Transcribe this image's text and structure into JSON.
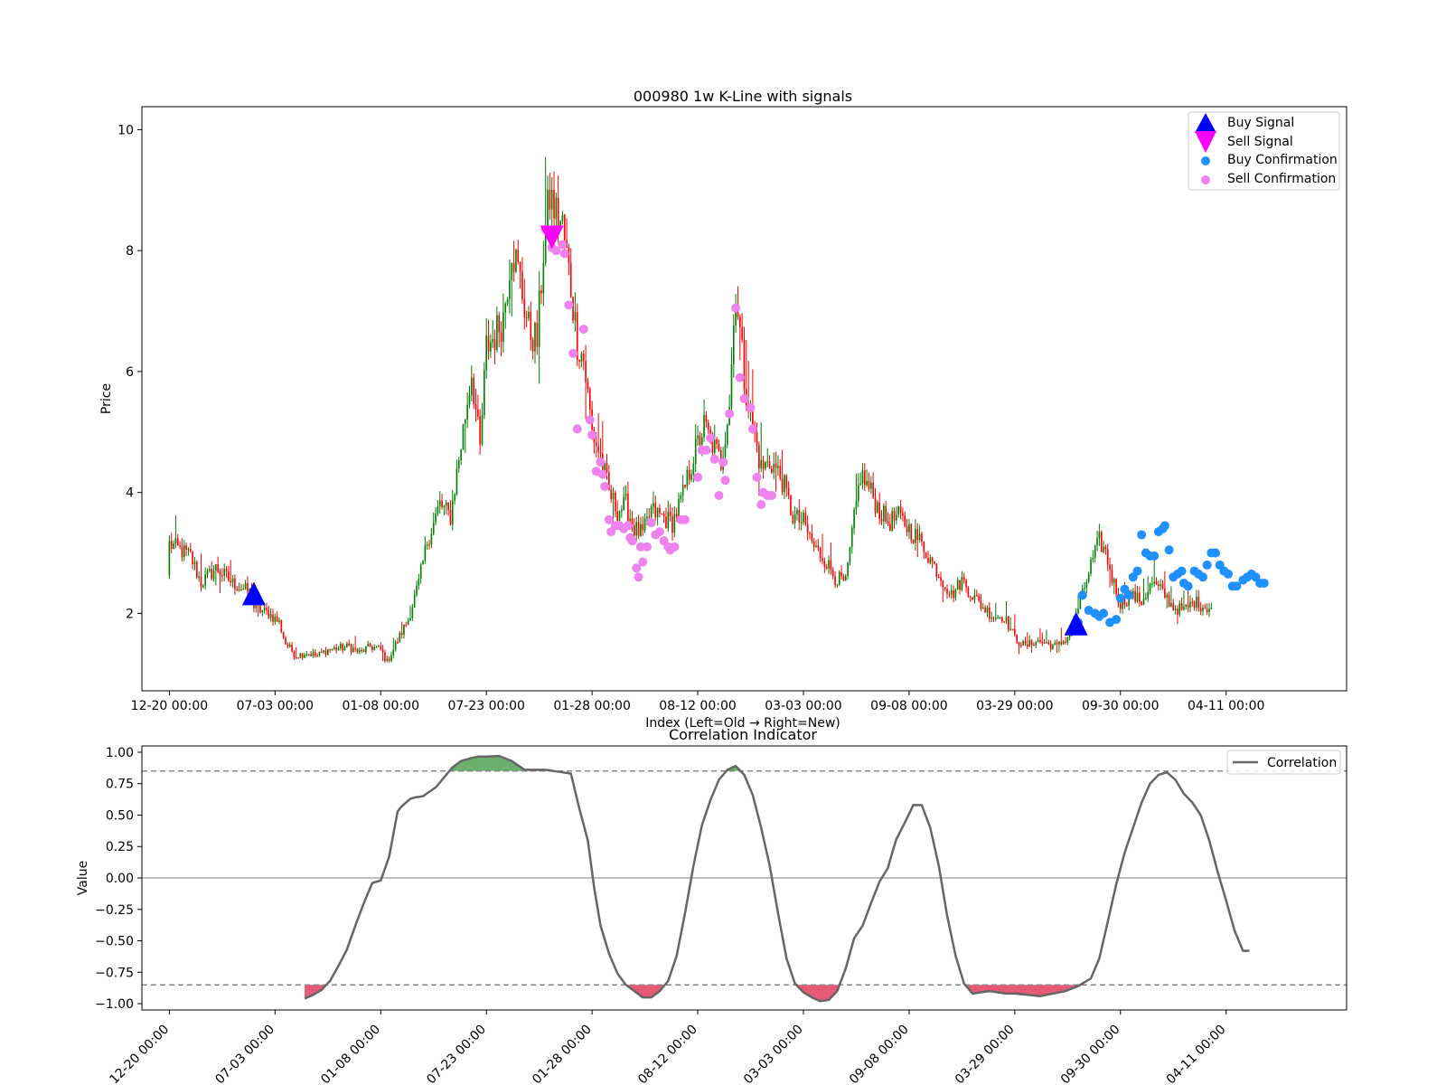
{
  "colors": {
    "up": "#008000",
    "down": "#ff0000",
    "buy_signal": "#0000ff",
    "sell_signal": "#ff00ff",
    "buy_confirmation": "#1e90ff",
    "sell_confirmation": "#ee82ee",
    "correlation_line": "#666666",
    "fill_high": "#2e8b2e",
    "fill_low": "#dc143c",
    "threshold": "#888888",
    "zero_line": "#aaaaaa"
  },
  "chart_data": [
    {
      "type": "candlestick",
      "title": "000980 1w K-Line with signals",
      "xlabel": "Index (Left=Old → Right=New)",
      "ylabel": "Price",
      "xlim": [
        -13,
        557
      ],
      "ylim": [
        0.72,
        10.38
      ],
      "yticks": [
        2,
        4,
        6,
        8,
        10
      ],
      "xtick_positions": [
        0,
        50,
        100,
        150,
        200,
        250,
        300,
        350,
        400,
        450,
        500
      ],
      "xtick_labels": [
        "12-20 00:00",
        "07-03 00:00",
        "01-08 00:00",
        "07-23 00:00",
        "01-28 00:00",
        "08-12 00:00",
        "03-03 00:00",
        "09-08 00:00",
        "03-29 00:00",
        "09-30 00:00",
        "04-11 00:00"
      ],
      "close_anchors": [
        [
          0,
          3.15
        ],
        [
          10,
          2.95
        ],
        [
          15,
          2.5
        ],
        [
          22,
          2.75
        ],
        [
          30,
          2.5
        ],
        [
          38,
          2.35
        ],
        [
          40,
          2.1
        ],
        [
          47,
          2.0
        ],
        [
          52,
          1.85
        ],
        [
          55,
          1.5
        ],
        [
          60,
          1.3
        ],
        [
          65,
          1.35
        ],
        [
          70,
          1.3
        ],
        [
          75,
          1.4
        ],
        [
          85,
          1.45
        ],
        [
          90,
          1.35
        ],
        [
          95,
          1.45
        ],
        [
          100,
          1.4
        ],
        [
          103,
          1.2
        ],
        [
          108,
          1.55
        ],
        [
          113,
          1.9
        ],
        [
          118,
          2.5
        ],
        [
          122,
          3.2
        ],
        [
          128,
          3.8
        ],
        [
          133,
          3.6
        ],
        [
          138,
          4.8
        ],
        [
          143,
          6.0
        ],
        [
          147,
          4.7
        ],
        [
          150,
          6.4
        ],
        [
          154,
          6.6
        ],
        [
          158,
          6.9
        ],
        [
          162,
          8.1
        ],
        [
          166,
          7.5
        ],
        [
          170,
          6.7
        ],
        [
          174,
          6.5
        ],
        [
          177,
          8.0
        ],
        [
          180,
          8.9
        ],
        [
          183,
          8.6
        ],
        [
          186,
          8.4
        ],
        [
          190,
          7.4
        ],
        [
          193,
          6.5
        ],
        [
          196,
          6.2
        ],
        [
          200,
          5.0
        ],
        [
          204,
          4.6
        ],
        [
          208,
          4.0
        ],
        [
          212,
          3.7
        ],
        [
          216,
          3.8
        ],
        [
          220,
          3.4
        ],
        [
          224,
          3.3
        ],
        [
          228,
          3.7
        ],
        [
          233,
          3.6
        ],
        [
          238,
          3.5
        ],
        [
          243,
          3.95
        ],
        [
          248,
          4.6
        ],
        [
          253,
          5.1
        ],
        [
          257,
          4.8
        ],
        [
          261,
          4.5
        ],
        [
          265,
          5.5
        ],
        [
          268,
          7.4
        ],
        [
          272,
          5.9
        ],
        [
          276,
          5.1
        ],
        [
          280,
          4.4
        ],
        [
          285,
          4.5
        ],
        [
          290,
          4.2
        ],
        [
          295,
          3.6
        ],
        [
          300,
          3.5
        ],
        [
          305,
          3.1
        ],
        [
          310,
          2.9
        ],
        [
          315,
          2.6
        ],
        [
          320,
          2.5
        ],
        [
          323,
          3.3
        ],
        [
          327,
          4.3
        ],
        [
          332,
          4.0
        ],
        [
          336,
          3.7
        ],
        [
          340,
          3.5
        ],
        [
          345,
          3.6
        ],
        [
          350,
          3.4
        ],
        [
          355,
          3.2
        ],
        [
          360,
          2.9
        ],
        [
          365,
          2.6
        ],
        [
          370,
          2.3
        ],
        [
          375,
          2.55
        ],
        [
          380,
          2.3
        ],
        [
          385,
          2.1
        ],
        [
          390,
          1.95
        ],
        [
          395,
          1.95
        ],
        [
          400,
          1.6
        ],
        [
          405,
          1.45
        ],
        [
          410,
          1.55
        ],
        [
          415,
          1.5
        ],
        [
          420,
          1.45
        ],
        [
          425,
          1.6
        ],
        [
          428,
          1.9
        ],
        [
          432,
          2.3
        ],
        [
          436,
          2.8
        ],
        [
          440,
          3.2
        ],
        [
          443,
          3.0
        ],
        [
          446,
          2.6
        ],
        [
          450,
          2.15
        ],
        [
          455,
          2.3
        ],
        [
          460,
          2.2
        ],
        [
          465,
          2.5
        ],
        [
          470,
          2.35
        ],
        [
          475,
          2.1
        ],
        [
          480,
          2.05
        ],
        [
          485,
          2.2
        ],
        [
          490,
          2.1
        ],
        [
          493,
          2.1
        ]
      ],
      "last_index": 493,
      "buy_signals": [
        [
          40,
          2.3
        ],
        [
          429,
          1.8
        ]
      ],
      "sell_signals": [
        [
          181,
          8.25
        ]
      ],
      "buy_confirmations": [
        [
          430,
          1.85
        ],
        [
          432,
          2.3
        ],
        [
          435,
          2.05
        ],
        [
          438,
          2.0
        ],
        [
          440,
          1.95
        ],
        [
          442,
          2.0
        ],
        [
          445,
          1.85
        ],
        [
          448,
          1.9
        ],
        [
          450,
          2.25
        ],
        [
          452,
          2.4
        ],
        [
          454,
          2.3
        ],
        [
          456,
          2.6
        ],
        [
          458,
          2.7
        ],
        [
          460,
          3.3
        ],
        [
          462,
          3.0
        ],
        [
          464,
          2.95
        ],
        [
          466,
          2.95
        ],
        [
          468,
          3.35
        ],
        [
          470,
          3.4
        ],
        [
          471,
          3.45
        ],
        [
          473,
          3.05
        ],
        [
          475,
          2.6
        ],
        [
          477,
          2.65
        ],
        [
          479,
          2.7
        ],
        [
          480,
          2.5
        ],
        [
          482,
          2.45
        ],
        [
          485,
          2.7
        ],
        [
          487,
          2.65
        ],
        [
          489,
          2.6
        ],
        [
          491,
          2.8
        ],
        [
          493,
          3.0
        ],
        [
          495,
          3.0
        ],
        [
          497,
          2.8
        ],
        [
          499,
          2.7
        ],
        [
          501,
          2.65
        ],
        [
          503,
          2.45
        ],
        [
          505,
          2.45
        ],
        [
          508,
          2.55
        ],
        [
          510,
          2.6
        ],
        [
          512,
          2.65
        ],
        [
          514,
          2.6
        ],
        [
          516,
          2.5
        ],
        [
          518,
          2.5
        ]
      ],
      "sell_confirmations": [
        [
          178,
          8.35
        ],
        [
          181,
          8.05
        ],
        [
          183,
          8.0
        ],
        [
          186,
          8.1
        ],
        [
          187,
          7.95
        ],
        [
          189,
          7.1
        ],
        [
          191,
          6.3
        ],
        [
          193,
          5.05
        ],
        [
          196,
          6.7
        ],
        [
          199,
          5.2
        ],
        [
          200,
          4.95
        ],
        [
          202,
          4.35
        ],
        [
          204,
          4.5
        ],
        [
          205,
          4.3
        ],
        [
          206,
          4.1
        ],
        [
          208,
          3.55
        ],
        [
          209,
          3.35
        ],
        [
          211,
          3.45
        ],
        [
          213,
          3.45
        ],
        [
          215,
          3.4
        ],
        [
          217,
          3.45
        ],
        [
          218,
          3.25
        ],
        [
          219,
          3.2
        ],
        [
          221,
          2.75
        ],
        [
          222,
          2.6
        ],
        [
          223,
          3.1
        ],
        [
          224,
          2.85
        ],
        [
          226,
          3.1
        ],
        [
          228,
          3.5
        ],
        [
          230,
          3.3
        ],
        [
          232,
          3.35
        ],
        [
          234,
          3.2
        ],
        [
          236,
          3.1
        ],
        [
          237,
          3.05
        ],
        [
          239,
          3.1
        ],
        [
          242,
          3.55
        ],
        [
          244,
          3.55
        ],
        [
          250,
          4.25
        ],
        [
          252,
          4.7
        ],
        [
          254,
          4.7
        ],
        [
          256,
          4.9
        ],
        [
          258,
          4.55
        ],
        [
          260,
          3.95
        ],
        [
          262,
          4.5
        ],
        [
          263,
          4.2
        ],
        [
          265,
          5.3
        ],
        [
          268,
          7.05
        ],
        [
          270,
          5.9
        ],
        [
          272,
          5.55
        ],
        [
          275,
          5.4
        ],
        [
          276,
          5.05
        ],
        [
          278,
          4.25
        ],
        [
          280,
          3.8
        ],
        [
          281,
          4.0
        ],
        [
          283,
          3.95
        ],
        [
          285,
          3.95
        ]
      ],
      "legend": {
        "placement": "upper right",
        "entries": [
          "Buy Signal",
          "Sell Signal",
          "Buy Confirmation",
          "Sell Confirmation"
        ]
      }
    },
    {
      "type": "line",
      "title": "Correlation Indicator",
      "ylabel": "Value",
      "xlim": [
        -13,
        557
      ],
      "ylim": [
        -1.05,
        1.05
      ],
      "yticks": [
        -1.0,
        -0.75,
        -0.5,
        -0.25,
        0.0,
        0.25,
        0.5,
        0.75,
        1.0
      ],
      "ytick_labels": [
        "−1.00",
        "−0.75",
        "−0.50",
        "−0.25",
        "0.00",
        "0.25",
        "0.50",
        "0.75",
        "1.00"
      ],
      "xtick_positions": [
        0,
        50,
        100,
        150,
        200,
        250,
        300,
        350,
        400,
        450,
        500
      ],
      "xtick_labels": [
        "12-20 00:00",
        "07-03 00:00",
        "01-08 00:00",
        "07-23 00:00",
        "01-28 00:00",
        "08-12 00:00",
        "03-03 00:00",
        "09-08 00:00",
        "03-29 00:00",
        "09-30 00:00",
        "04-11 00:00"
      ],
      "thresholds": [
        0.85,
        -0.85
      ],
      "zero_line": 0,
      "legend": {
        "placement": "upper right",
        "entries": [
          "Correlation"
        ]
      },
      "series": [
        {
          "name": "Correlation",
          "x": [
            64,
            68,
            72,
            76,
            80,
            84,
            88,
            92,
            96,
            100,
            104,
            108,
            110,
            112,
            114,
            116,
            120,
            126,
            130,
            134,
            138,
            142,
            146,
            150,
            156,
            162,
            168,
            174,
            178,
            182,
            186,
            190,
            194,
            198,
            201,
            204,
            208,
            212,
            216,
            220,
            224,
            228,
            232,
            236,
            240,
            244,
            248,
            252,
            256,
            258,
            260,
            264,
            268,
            272,
            276,
            280,
            284,
            288,
            292,
            296,
            300,
            304,
            308,
            312,
            316,
            320,
            324,
            328,
            332,
            336,
            340,
            342,
            344,
            348,
            352,
            356,
            360,
            364,
            368,
            372,
            376,
            380,
            384,
            388,
            392,
            396,
            400,
            406,
            412,
            418,
            424,
            430,
            436,
            440,
            444,
            448,
            452,
            456,
            460,
            464,
            468,
            472,
            476,
            480,
            484,
            488,
            492,
            496,
            500,
            504,
            508,
            511
          ],
          "y": [
            -0.96,
            -0.93,
            -0.89,
            -0.82,
            -0.7,
            -0.57,
            -0.38,
            -0.2,
            -0.04,
            -0.02,
            0.17,
            0.53,
            0.57,
            0.6,
            0.63,
            0.64,
            0.65,
            0.72,
            0.8,
            0.88,
            0.93,
            0.95,
            0.965,
            0.965,
            0.97,
            0.93,
            0.86,
            0.86,
            0.86,
            0.85,
            0.84,
            0.83,
            0.55,
            0.3,
            -0.08,
            -0.38,
            -0.6,
            -0.76,
            -0.85,
            -0.9,
            -0.95,
            -0.95,
            -0.9,
            -0.82,
            -0.62,
            -0.28,
            0.1,
            0.42,
            0.62,
            0.7,
            0.78,
            0.86,
            0.89,
            0.82,
            0.66,
            0.4,
            0.1,
            -0.28,
            -0.64,
            -0.84,
            -0.91,
            -0.95,
            -0.98,
            -0.97,
            -0.9,
            -0.72,
            -0.48,
            -0.38,
            -0.2,
            -0.03,
            0.08,
            0.2,
            0.31,
            0.44,
            0.58,
            0.58,
            0.4,
            0.1,
            -0.3,
            -0.62,
            -0.84,
            -0.92,
            -0.91,
            -0.9,
            -0.91,
            -0.92,
            -0.92,
            -0.93,
            -0.94,
            -0.92,
            -0.9,
            -0.86,
            -0.8,
            -0.64,
            -0.35,
            -0.05,
            0.2,
            0.4,
            0.6,
            0.75,
            0.82,
            0.84,
            0.78,
            0.67,
            0.6,
            0.5,
            0.3,
            0.05,
            -0.18,
            -0.42,
            -0.58,
            -0.58
          ]
        }
      ]
    }
  ]
}
